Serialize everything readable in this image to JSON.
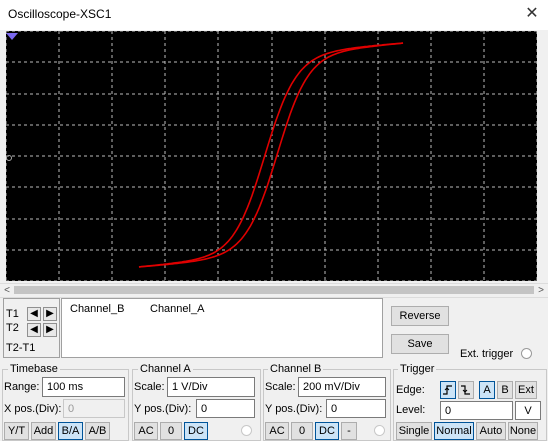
{
  "window": {
    "title": "Oscilloscope-XSC1",
    "close_glyph": "✕"
  },
  "cursors": {
    "t1": "T1",
    "t2": "T2",
    "t2t1": "T2-T1",
    "left_glyph": "◀",
    "right_glyph": "▶"
  },
  "readout": {
    "col1": "Channel_B",
    "col2": "Channel_A"
  },
  "buttons": {
    "reverse": "Reverse",
    "save": "Save",
    "ext_trigger": "Ext. trigger"
  },
  "timebase": {
    "title": "Timebase",
    "range_label": "Range:",
    "range_value": "100 ms",
    "xpos_label": "X pos.(Div):",
    "xpos_value": "0",
    "modes": [
      "Y/T",
      "Add",
      "B/A",
      "A/B"
    ],
    "active_mode": "B/A"
  },
  "channel_a": {
    "title": "Channel A",
    "scale_label": "Scale:",
    "scale_value": "1  V/Div",
    "ypos_label": "Y pos.(Div):",
    "ypos_value": "0",
    "coupling": [
      "AC",
      "0",
      "DC"
    ],
    "active": "DC"
  },
  "channel_b": {
    "title": "Channel B",
    "scale_label": "Scale:",
    "scale_value": "200 mV/Div",
    "ypos_label": "Y pos.(Div):",
    "ypos_value": "0",
    "coupling": [
      "AC",
      "0",
      "DC",
      "-"
    ],
    "active": "DC"
  },
  "trigger": {
    "title": "Trigger",
    "edge_label": "Edge:",
    "level_label": "Level:",
    "level_value": "0",
    "level_unit": "V",
    "sources": [
      "A",
      "B",
      "Ext"
    ],
    "active_source": "A",
    "edges": [
      "rising-edge-icon",
      "falling-edge-icon"
    ],
    "modes": [
      "Single",
      "Normal",
      "Auto",
      "None"
    ],
    "active_mode": "Normal"
  },
  "colors": {
    "trace": "#e00000",
    "screen": "#000000",
    "grid": "#bdbdbd"
  }
}
